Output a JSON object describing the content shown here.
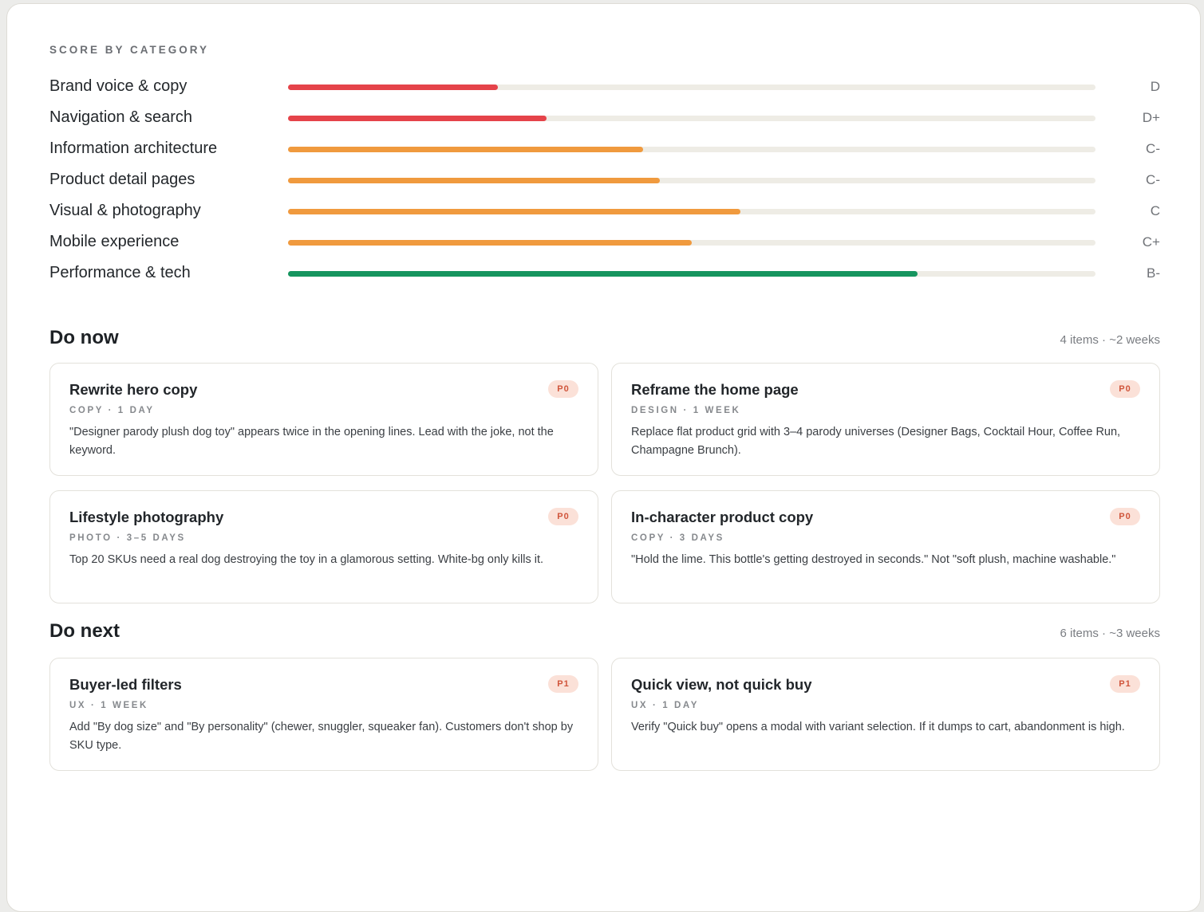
{
  "colors": {
    "red": "#e5434a",
    "orange": "#f09a3e",
    "green": "#16955f",
    "track": "#eeece5",
    "p0_bg": "#fbe1d8",
    "p0_text": "#d0553b",
    "p1_bg": "#fbe1d8",
    "p1_text": "#d0553b"
  },
  "scores": {
    "heading": "SCORE BY CATEGORY",
    "items": [
      {
        "label": "Brand voice & copy",
        "grade": "D",
        "level": 0.26,
        "color": "#e5434a"
      },
      {
        "label": "Navigation & search",
        "grade": "D+",
        "level": 0.32,
        "color": "#e5434a"
      },
      {
        "label": "Information architecture",
        "grade": "C-",
        "level": 0.44,
        "color": "#f09a3e"
      },
      {
        "label": "Product detail pages",
        "grade": "C-",
        "level": 0.46,
        "color": "#f09a3e"
      },
      {
        "label": "Visual & photography",
        "grade": "C",
        "level": 0.56,
        "color": "#f09a3e"
      },
      {
        "label": "Mobile experience",
        "grade": "C+",
        "level": 0.5,
        "color": "#f09a3e"
      },
      {
        "label": "Performance & tech",
        "grade": "B-",
        "level": 0.78,
        "color": "#16955f"
      }
    ]
  },
  "do_now": {
    "title": "Do now",
    "meta": "4 items · ~2 weeks",
    "cards": [
      {
        "title": "Rewrite hero copy",
        "tag": "COPY · 1 DAY",
        "priority": "P0",
        "desc": "\"Designer parody plush dog toy\" appears twice in the opening lines. Lead with the joke, not the keyword."
      },
      {
        "title": "Reframe the home page",
        "tag": "DESIGN · 1 WEEK",
        "priority": "P0",
        "desc": "Replace flat product grid with 3–4 parody universes (Designer Bags, Cocktail Hour, Coffee Run, Champagne Brunch)."
      },
      {
        "title": "Lifestyle photography",
        "tag": "PHOTO · 3–5 DAYS",
        "priority": "P0",
        "desc": "Top 20 SKUs need a real dog destroying the toy in a glamorous setting. White-bg only kills it."
      },
      {
        "title": "In-character product copy",
        "tag": "COPY · 3 DAYS",
        "priority": "P0",
        "desc": "\"Hold the lime. This bottle's getting destroyed in seconds.\" Not \"soft plush, machine washable.\""
      }
    ]
  },
  "do_next": {
    "title": "Do next",
    "meta": "6 items · ~3 weeks",
    "cards": [
      {
        "title": "Buyer-led filters",
        "tag": "UX · 1 WEEK",
        "priority": "P1",
        "desc": "Add \"By dog size\" and \"By personality\" (chewer, snuggler, squeaker fan). Customers don't shop by SKU type."
      },
      {
        "title": "Quick view, not quick buy",
        "tag": "UX · 1 DAY",
        "priority": "P1",
        "desc": "Verify \"Quick buy\" opens a modal with variant selection. If it dumps to cart, abandonment is high."
      }
    ]
  }
}
